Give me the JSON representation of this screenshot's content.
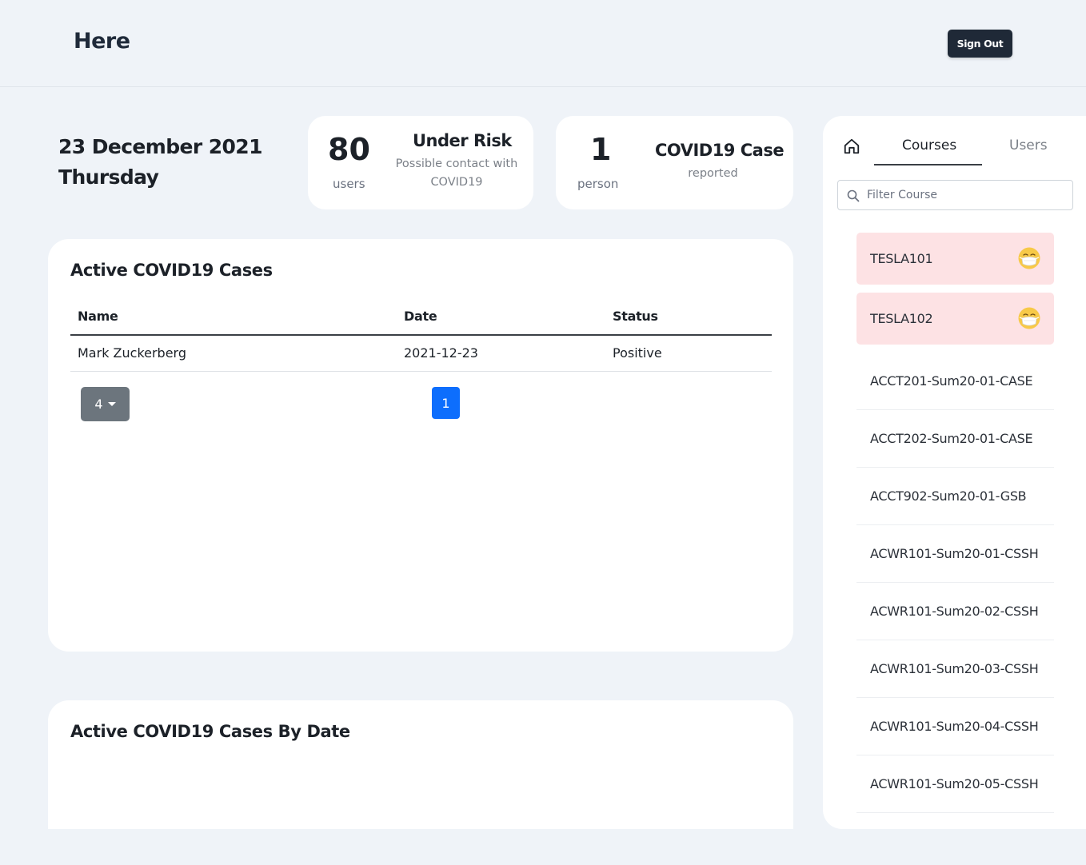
{
  "header": {
    "brand": "Here",
    "sign_out_label": "Sign Out"
  },
  "date": {
    "date_line": "23 December 2021",
    "weekday": "Thursday"
  },
  "stats": {
    "under_risk": {
      "number": "80",
      "unit": "users",
      "title": "Under Risk",
      "subtitle_line1": "Possible contact with",
      "subtitle_line2": "COVID19"
    },
    "cases": {
      "number": "1",
      "unit": "person",
      "title": "COVID19 Case",
      "subtitle": "reported"
    }
  },
  "active_cases": {
    "title": "Active COVID19 Cases",
    "columns": [
      "Name",
      "Date",
      "Status"
    ],
    "rows": [
      {
        "name": "Mark Zuckerberg",
        "date": "2021-12-23",
        "status": "Positive"
      }
    ],
    "page_size": "4",
    "current_page": "1"
  },
  "by_date": {
    "title": "Active COVID19 Cases By Date"
  },
  "sidebar": {
    "tabs": [
      "Courses",
      "Users"
    ],
    "active_tab": "Courses",
    "filter_placeholder": "Filter Course",
    "courses": [
      {
        "name": "TESLA101",
        "at_risk": true
      },
      {
        "name": "TESLA102",
        "at_risk": true
      },
      {
        "name": "ACCT201-Sum20-01-CASE",
        "at_risk": false
      },
      {
        "name": "ACCT202-Sum20-01-CASE",
        "at_risk": false
      },
      {
        "name": "ACCT902-Sum20-01-GSB",
        "at_risk": false
      },
      {
        "name": "ACWR101-Sum20-01-CSSH",
        "at_risk": false
      },
      {
        "name": "ACWR101-Sum20-02-CSSH",
        "at_risk": false
      },
      {
        "name": "ACWR101-Sum20-03-CSSH",
        "at_risk": false
      },
      {
        "name": "ACWR101-Sum20-04-CSSH",
        "at_risk": false
      },
      {
        "name": "ACWR101-Sum20-05-CSSH",
        "at_risk": false
      }
    ]
  },
  "icons": {
    "home": "home-icon",
    "search": "search-icon",
    "mask": "face-with-medical-mask-icon",
    "caret": "caret-down-icon"
  },
  "colors": {
    "at_risk_bg": "#fde2e4",
    "primary": "#0d6efd",
    "dark_button": "#1f2937"
  }
}
